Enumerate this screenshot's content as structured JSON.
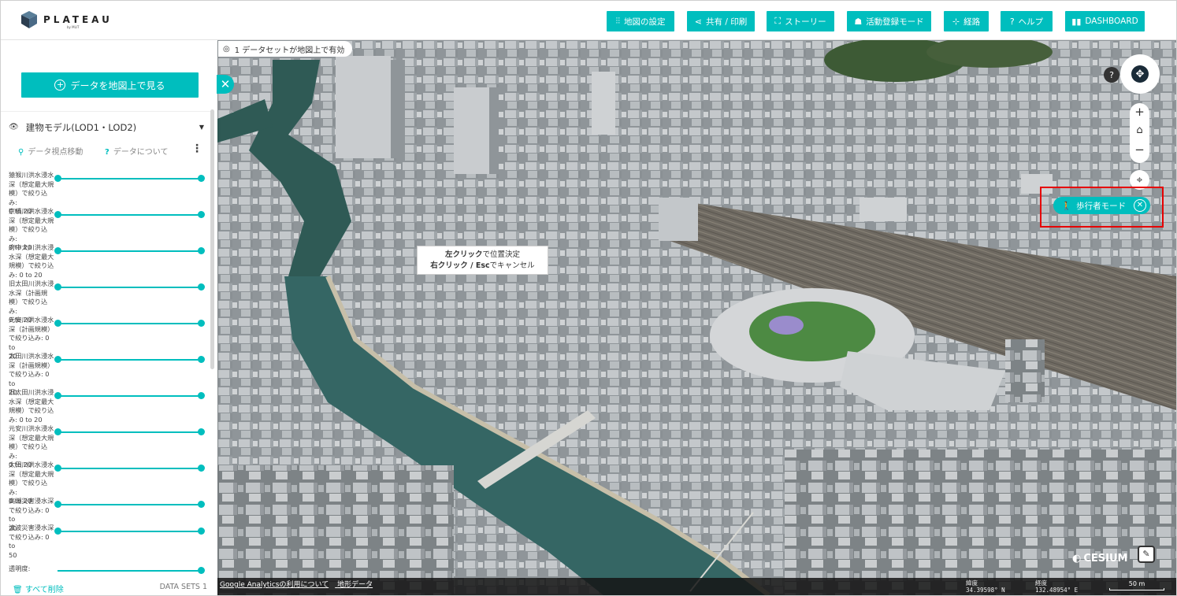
{
  "header": {
    "logo_text": "PLATEAU",
    "logo_sub": "by MLIT",
    "buttons": [
      {
        "label": "地図の設定",
        "icon": "⫶⫶"
      },
      {
        "label": "共有 / 印刷",
        "icon": "⋖"
      },
      {
        "label": "ストーリー",
        "icon": "⛶"
      },
      {
        "label": "活動登録モード",
        "icon": "☗"
      },
      {
        "label": "経路",
        "icon": "⊹"
      },
      {
        "label": "ヘルプ",
        "icon": "?"
      },
      {
        "label": "DASHBOARD",
        "icon": "▮▮"
      }
    ]
  },
  "sidebar": {
    "view_button_label": "データを地図上で見る",
    "layer": {
      "title": "建物モデル(LOD1・LOD2)",
      "action_move": "データ視点移動",
      "action_about": "データについて"
    },
    "filters": [
      {
        "label": "猿猴川洪水浸水深（想定最大規模）で絞り込み: 0 to 20",
        "lines": [
          "猿猴川洪水浸水",
          "深（想定最大規",
          "模）で絞り込み:",
          "0 to 20"
        ]
      },
      {
        "label": "京橋川洪水浸水深（想定最大規模）で絞り込み: 0 to 20",
        "lines": [
          "京橋川洪水浸水",
          "深（想定最大規",
          "模）で絞り込み:",
          "0 to 20"
        ]
      },
      {
        "label": "府中大川洪水浸水深（想定最大規模）で絞り込み: 0 to 20",
        "lines": [
          "府中大川洪水浸",
          "水深（想定最大",
          "規模）で絞り込",
          "み: 0 to 20"
        ]
      },
      {
        "label": "旧太田川洪水浸水深（計画規模）で絞り込み: 0 to 20",
        "lines": [
          "旧太田川洪水浸",
          "水深（計画規",
          "模）で絞り込み:",
          "0 to 20"
        ]
      },
      {
        "label": "元安川洪水浸水深（計画規模）で絞り込み: 0 to 20",
        "lines": [
          "元安川洪水浸水",
          "深（計画規模）",
          "で絞り込み: 0 to",
          "20"
        ]
      },
      {
        "label": "太田川洪水浸水深（計画規模）で絞り込み: 0 to 20",
        "lines": [
          "太田川洪水浸水",
          "深（計画規模）",
          "で絞り込み: 0 to",
          "20"
        ]
      },
      {
        "label": "旧太田川洪水浸水深（想定最大規模）で絞り込み: 0 to 20",
        "lines": [
          "旧太田川洪水浸",
          "水深（想定最大",
          "規模）で絞り込",
          "み: 0 to 20"
        ]
      },
      {
        "label": "元安川洪水浸水深（想定最大規模）で絞り込み: 0 to 20",
        "lines": [
          "元安川洪水浸水",
          "深（想定最大規",
          "模）で絞り込み:",
          "0 to 20"
        ]
      },
      {
        "label": "太田川洪水浸水深（想定最大規模）で絞り込み: 0 to 20",
        "lines": [
          "太田川洪水浸水",
          "深（想定最大規",
          "模）で絞り込み:",
          "0 to 20"
        ]
      },
      {
        "label": "高潮災害浸水深で絞り込み: 0 to 20",
        "lines": [
          "高潮災害浸水深",
          "で絞り込み: 0 to",
          "20"
        ]
      },
      {
        "label": "津波災害浸水深で絞り込み: 0 to 50",
        "lines": [
          "津波災害浸水深",
          "で絞り込み: 0 to",
          "50"
        ]
      }
    ],
    "opacity_label": "透明度:",
    "delete_all": "すべて削除",
    "datasets_count": "DATA SETS 1"
  },
  "map": {
    "status_chip": "1 データセットが地図上で有効",
    "tooltip_line1_bold": "左クリック",
    "tooltip_line1_rest": "で位置決定",
    "tooltip_line2_bold": "右クリック / Esc",
    "tooltip_line2_rest": "でキャンセル",
    "walk_mode_label": "歩行者モード",
    "footer_links": [
      "Google Analyticsの利用について",
      "地形データ"
    ],
    "lat_label": "緯度",
    "lat_value": "34.39598° N",
    "lon_label": "経度",
    "lon_value": "132.48954° E",
    "scale_label": "50 m",
    "cesium_label": "CESIUM"
  },
  "colors": {
    "accent": "#00bebe",
    "highlight_box": "#e60000"
  }
}
